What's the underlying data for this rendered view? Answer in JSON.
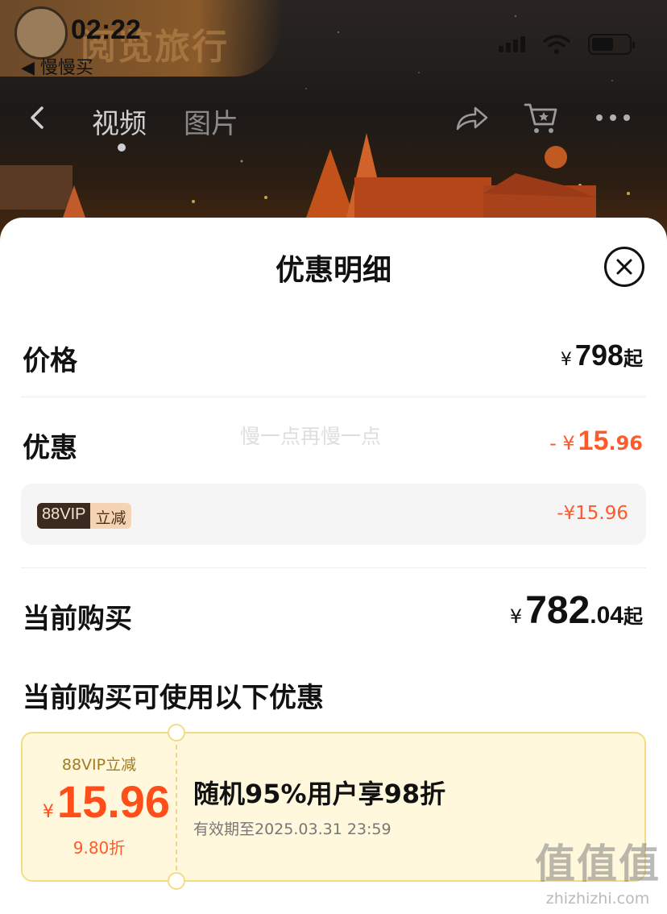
{
  "status_bar": {
    "time": "02:22",
    "back_app": "◀ 慢慢买",
    "banner_text": "阅览旅行"
  },
  "nav": {
    "tabs": [
      "视频",
      "图片"
    ],
    "active_tab": "视频"
  },
  "sheet": {
    "title": "优惠明细",
    "watermark": "慢一点再慢一点",
    "price": {
      "label": "价格",
      "currency": "¥",
      "value": "798",
      "suffix": "起"
    },
    "discount": {
      "label": "优惠",
      "prefix": "- ¥",
      "value_int": "15",
      "value_dec": ".96",
      "items": [
        {
          "badge_left": "88VIP",
          "badge_right": "立减",
          "amount": "-¥15.96"
        }
      ]
    },
    "current": {
      "label": "当前购买",
      "currency": "¥",
      "value_int": "782",
      "value_dec": ".04",
      "suffix": "起"
    },
    "coupons_title": "当前购买可使用以下优惠",
    "coupon": {
      "type_label": "88VIP立减",
      "currency": "¥",
      "amount": "15.96",
      "discount_text": "9.80折",
      "title": "随机95%用户享98折",
      "validity": "有效期至2025.03.31 23:59"
    }
  },
  "corner_watermark": {
    "big": "值值值",
    "small": "zhizhizhi.com"
  },
  "colors": {
    "accent_orange": "#ff5a2a",
    "coupon_bg": "#fff8dc"
  }
}
